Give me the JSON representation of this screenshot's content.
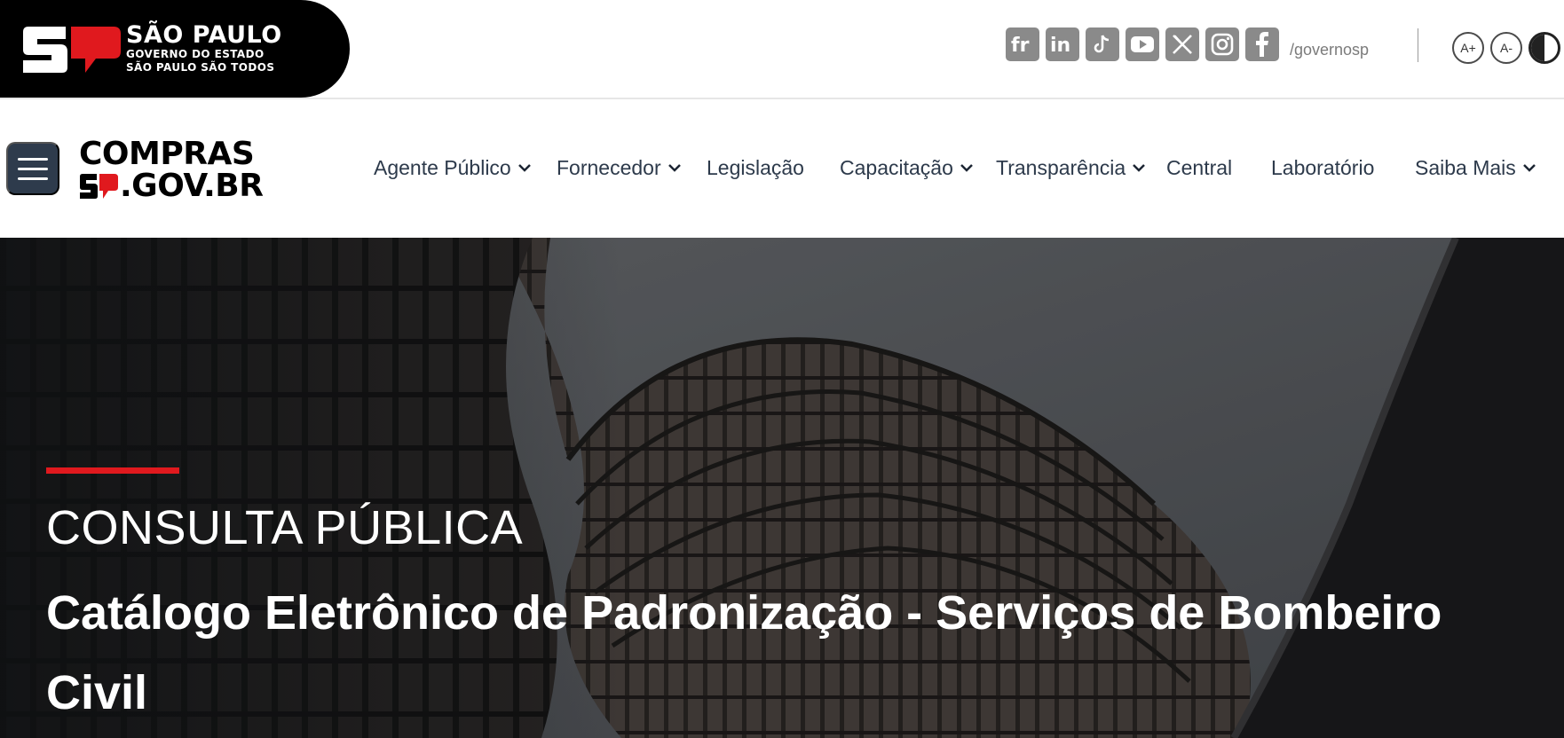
{
  "gov": {
    "title": "SÃO PAULO",
    "line2": "GOVERNO DO ESTADO",
    "line3": "SÃO PAULO SÃO TODOS"
  },
  "social": {
    "icons": [
      "flickr-icon",
      "linkedin-icon",
      "tiktok-icon",
      "youtube-icon",
      "x-icon",
      "instagram-icon",
      "facebook-icon"
    ],
    "handle": "/governosp"
  },
  "accessibility": {
    "increase": "A+",
    "decrease": "A-"
  },
  "logo": {
    "line1": "COMPRAS",
    "line2": ".GOV.BR"
  },
  "nav": {
    "items": [
      {
        "label": "Agente Público",
        "dropdown": true
      },
      {
        "label": "Fornecedor",
        "dropdown": true
      },
      {
        "label": "Legislação",
        "dropdown": false
      },
      {
        "label": "Capacitação",
        "dropdown": true
      },
      {
        "label": "Transparência",
        "dropdown": true
      },
      {
        "label": "Central",
        "dropdown": false
      },
      {
        "label": "Laboratório",
        "dropdown": false
      },
      {
        "label": "Saiba Mais",
        "dropdown": true
      }
    ]
  },
  "hero": {
    "eyebrow": "CONSULTA PÚBLICA",
    "title": "Catálogo Eletrônico de Padronização - Serviços de Bombeiro Civil"
  },
  "colors": {
    "brand_red": "#e0191e",
    "nav_text": "#2d3a4b",
    "menu_button": "#2e3b4c",
    "social_gray": "#8a8a8a"
  }
}
